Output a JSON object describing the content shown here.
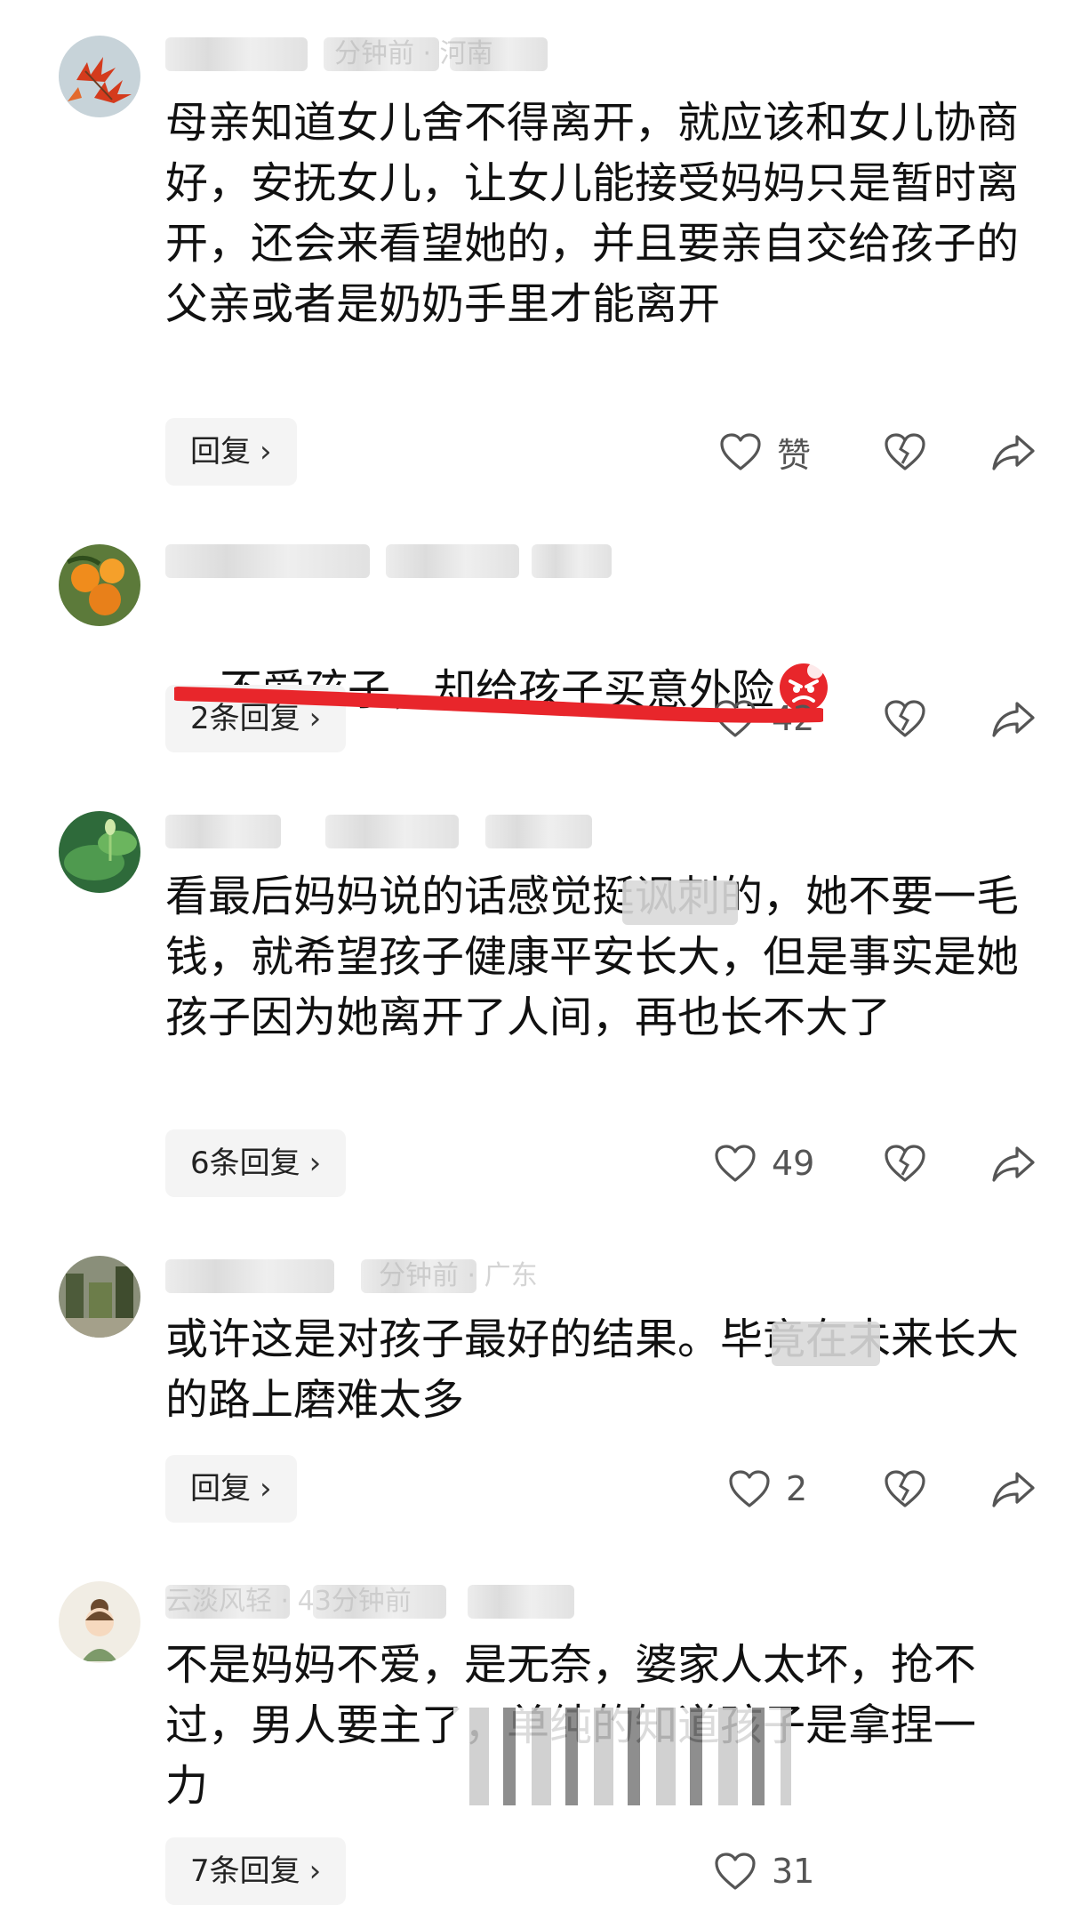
{
  "comments": [
    {
      "meta_visible": "分钟前 · 河南",
      "text": "母亲知道女儿舍不得离开，就应该和女儿协商好，安抚女儿，让女儿能接受妈妈只是暂时离开，还会来看望她的，并且要亲自交给孩子的父亲或者是奶奶手里才能离开",
      "reply_label": "回复",
      "like_label": "赞"
    },
    {
      "meta_visible": "",
      "text": "不爱孩子，却给孩子买意外险",
      "reply_label": "2条回复",
      "like_label": "42"
    },
    {
      "meta_visible": "",
      "text": "看最后妈妈说的话感觉挺讽刺的，她不要一毛钱，就希望孩子健康平安长大，但是事实是她孩子因为她离开了人间，再也长不大了",
      "reply_label": "6条回复",
      "like_label": "49"
    },
    {
      "meta_visible": "分钟前 · 广东",
      "text": "或许这是对孩子最好的结果。毕竟在未来长大的路上磨难太多",
      "reply_label": "回复",
      "like_label": "2"
    },
    {
      "meta_visible": "云淡风轻 · 43分钟前",
      "text": "不是妈妈不爱，是无奈，婆家人太坏，抢不过，男人要主了，单纯的知道孩子是拿捏一    力",
      "reply_label": "7条回复",
      "like_label": "31"
    }
  ],
  "icons": {
    "chevron": "›",
    "heart": "heart-icon",
    "broken_heart": "broken-heart-icon",
    "share": "share-icon",
    "angry_emoji": "angry-face-icon"
  },
  "colors": {
    "accent_red": "#e8262b",
    "reply_bg": "#f4f4f4",
    "text": "#111111",
    "icon": "#555555"
  }
}
